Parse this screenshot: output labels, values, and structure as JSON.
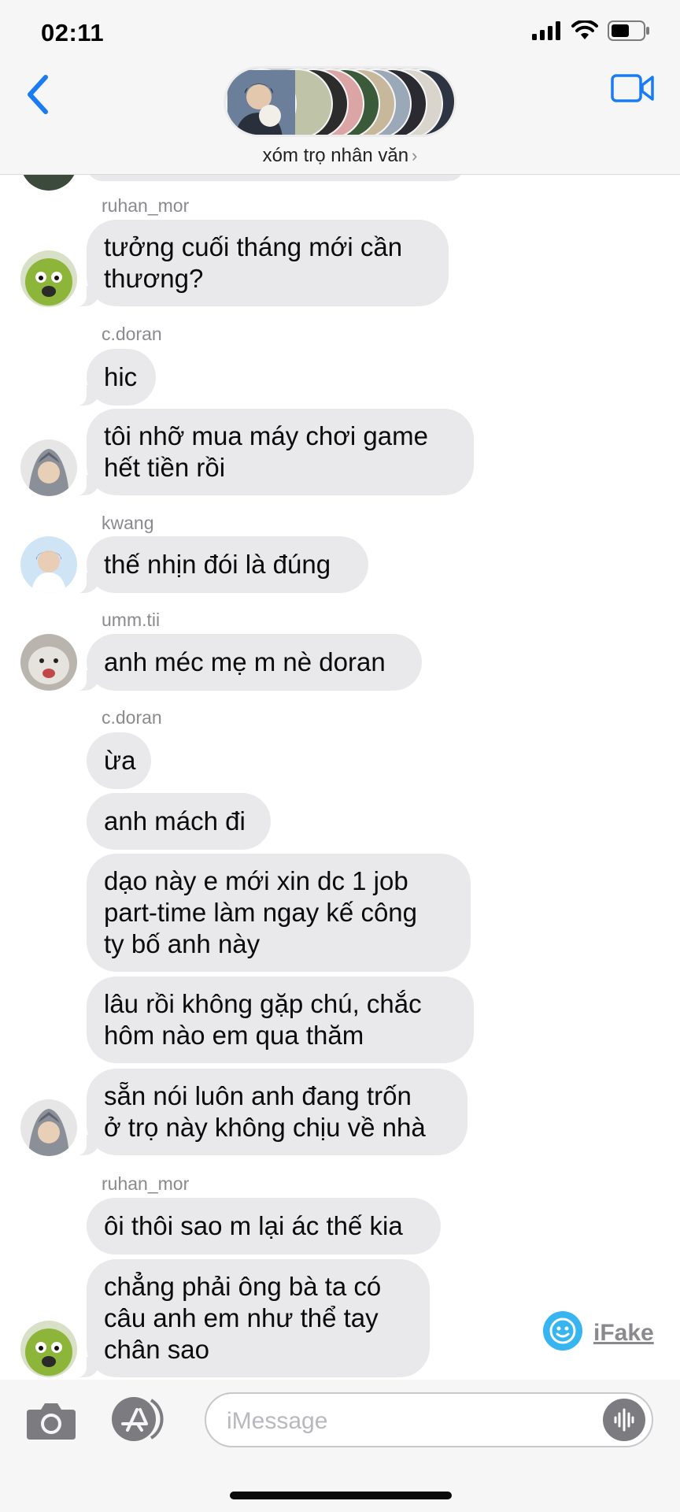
{
  "status_bar": {
    "time": "02:11"
  },
  "header": {
    "group_name": "xóm trọ nhân văn",
    "group_name_chevron": "›"
  },
  "colors": {
    "accent": "#1a7cf3",
    "bubble_received": "#e9e9eb",
    "sender_text": "#8a8a8e",
    "watermark": "#36b5f0"
  },
  "messages": [
    {
      "sender": "ruhan_mor",
      "text": "tưởng cuối tháng mới cần\nthương?"
    },
    {
      "sender": "c.doran",
      "text": "hic"
    },
    {
      "sender": "",
      "text": "tôi nhỡ mua máy chơi game\nhết tiền rồi"
    },
    {
      "sender": "kwang",
      "text": "thế nhịn đói là đúng"
    },
    {
      "sender": "umm.tii",
      "text": "anh méc mẹ m nè doran"
    },
    {
      "sender": "c.doran",
      "text": "ừa"
    },
    {
      "sender": "",
      "text": "anh mách đi"
    },
    {
      "sender": "",
      "text": "dạo này e mới xin dc 1 job\npart-time làm ngay kế công\nty bố anh này"
    },
    {
      "sender": "",
      "text": "lâu rồi không gặp chú, chắc\nhôm nào em qua thăm"
    },
    {
      "sender": "",
      "text": "sẵn nói luôn anh đang trốn\nở trọ này không chịu về nhà"
    },
    {
      "sender": "ruhan_mor",
      "text": "ôi thôi sao m lại ác thế kia"
    },
    {
      "sender": "",
      "text": "chẳng phải ông bà ta có\ncâu anh em như thể tay\nchân sao"
    }
  ],
  "watermark": {
    "label": "iFake",
    "icon": "smiley-icon"
  },
  "input": {
    "placeholder": "iMessage"
  },
  "icons": [
    "back-chevron-icon",
    "video-camera-icon",
    "camera-icon",
    "app-store-icon",
    "audio-waveform-icon",
    "signal-icon",
    "wifi-icon",
    "battery-icon"
  ]
}
